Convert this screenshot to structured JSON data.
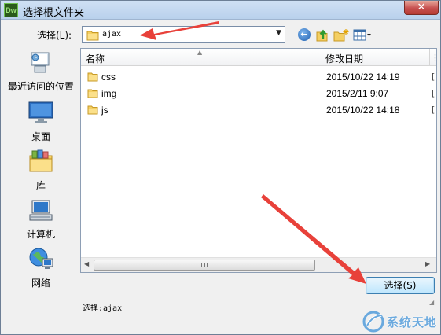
{
  "window": {
    "title": "选择根文件夹",
    "app_icon_text": "Dw",
    "close_glyph": "✕"
  },
  "lookin": {
    "label": "选择(L):",
    "value": "ajax"
  },
  "places": [
    {
      "label": "最近访问的位置",
      "icon": "recent-places-icon"
    },
    {
      "label": "桌面",
      "icon": "desktop-icon"
    },
    {
      "label": "库",
      "icon": "libraries-icon"
    },
    {
      "label": "计算机",
      "icon": "computer-icon"
    },
    {
      "label": "网络",
      "icon": "network-icon"
    }
  ],
  "filelist": {
    "columns": [
      "名称",
      "修改日期"
    ],
    "rows": [
      {
        "name": "css",
        "date": "2015/10/22 14:19"
      },
      {
        "name": "img",
        "date": "2015/2/11 9:07"
      },
      {
        "name": "js",
        "date": "2015/10/22 14:18"
      }
    ]
  },
  "footer": {
    "select_button": "选择(S)",
    "selection_text": "选择:ajax"
  },
  "watermark": {
    "text": "系统天地"
  },
  "colors": {
    "arrow": "#e8413a",
    "accent": "#3c7fb1"
  }
}
